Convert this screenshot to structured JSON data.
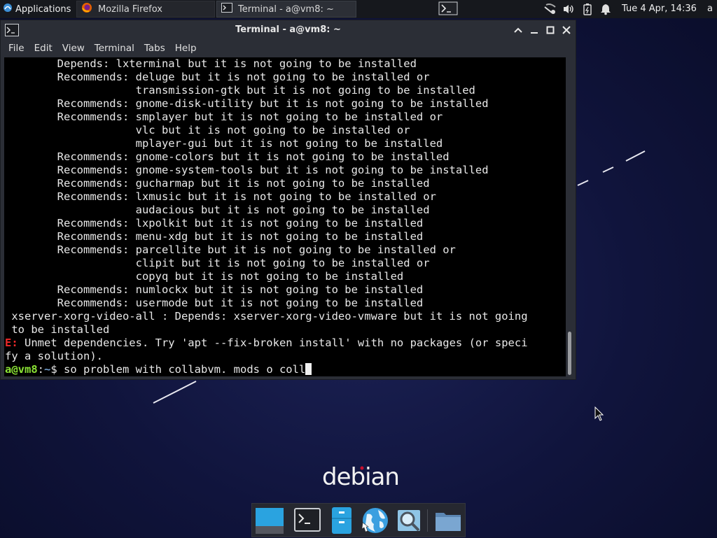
{
  "top_panel": {
    "applications_label": "Applications",
    "tasks": [
      {
        "label": "Mozilla Firefox",
        "icon": "firefox-icon"
      },
      {
        "label": "Terminal - a@vm8: ~",
        "icon": "terminal-icon"
      }
    ],
    "clock": "Tue  4 Apr, 14:36",
    "user": "a",
    "tray_icons": [
      "network-icon",
      "volume-icon",
      "battery-icon",
      "notifications-bell-icon"
    ]
  },
  "window": {
    "title": "Terminal - a@vm8: ~",
    "menu": [
      "File",
      "Edit",
      "View",
      "Terminal",
      "Tabs",
      "Help"
    ]
  },
  "terminal": {
    "lines": [
      "        Depends: lxterminal but it is not going to be installed",
      "        Recommends: deluge but it is not going to be installed or",
      "                    transmission-gtk but it is not going to be installed",
      "        Recommends: gnome-disk-utility but it is not going to be installed",
      "        Recommends: smplayer but it is not going to be installed or",
      "                    vlc but it is not going to be installed or",
      "                    mplayer-gui but it is not going to be installed",
      "        Recommends: gnome-colors but it is not going to be installed",
      "        Recommends: gnome-system-tools but it is not going to be installed",
      "        Recommends: gucharmap but it is not going to be installed",
      "        Recommends: lxmusic but it is not going to be installed or",
      "                    audacious but it is not going to be installed",
      "        Recommends: lxpolkit but it is not going to be installed",
      "        Recommends: menu-xdg but it is not going to be installed",
      "        Recommends: parcellite but it is not going to be installed or",
      "                    clipit but it is not going to be installed or",
      "                    copyq but it is not going to be installed",
      "        Recommends: numlockx but it is not going to be installed",
      "        Recommends: usermode but it is not going to be installed",
      " xserver-xorg-video-all : Depends: xserver-xorg-video-vmware but it is not going",
      " to be installed"
    ],
    "error_prefix": "E:",
    "error_line1": " Unmet dependencies. Try 'apt --fix-broken install' with no packages (or speci",
    "error_line2": "fy a solution).",
    "prompt_user": "a@vm8",
    "prompt_sep": ":",
    "prompt_path": "~",
    "prompt_dollar": "$ ",
    "command": "so problem with collabvm. mods o coll"
  },
  "desktop": {
    "logo_text": "debian",
    "dock": [
      "show-desktop-icon",
      "terminal-icon",
      "file-manager-icon",
      "web-browser-icon",
      "search-icon",
      "folder-icon"
    ]
  },
  "colors": {
    "panel_bg": "#16181d",
    "window_bg": "#2b2e36",
    "terminal_bg": "#000000",
    "error_red": "#ef2929",
    "prompt_green": "#8ae234",
    "prompt_blue": "#729fcf",
    "desktop_bg": "#10143c"
  }
}
